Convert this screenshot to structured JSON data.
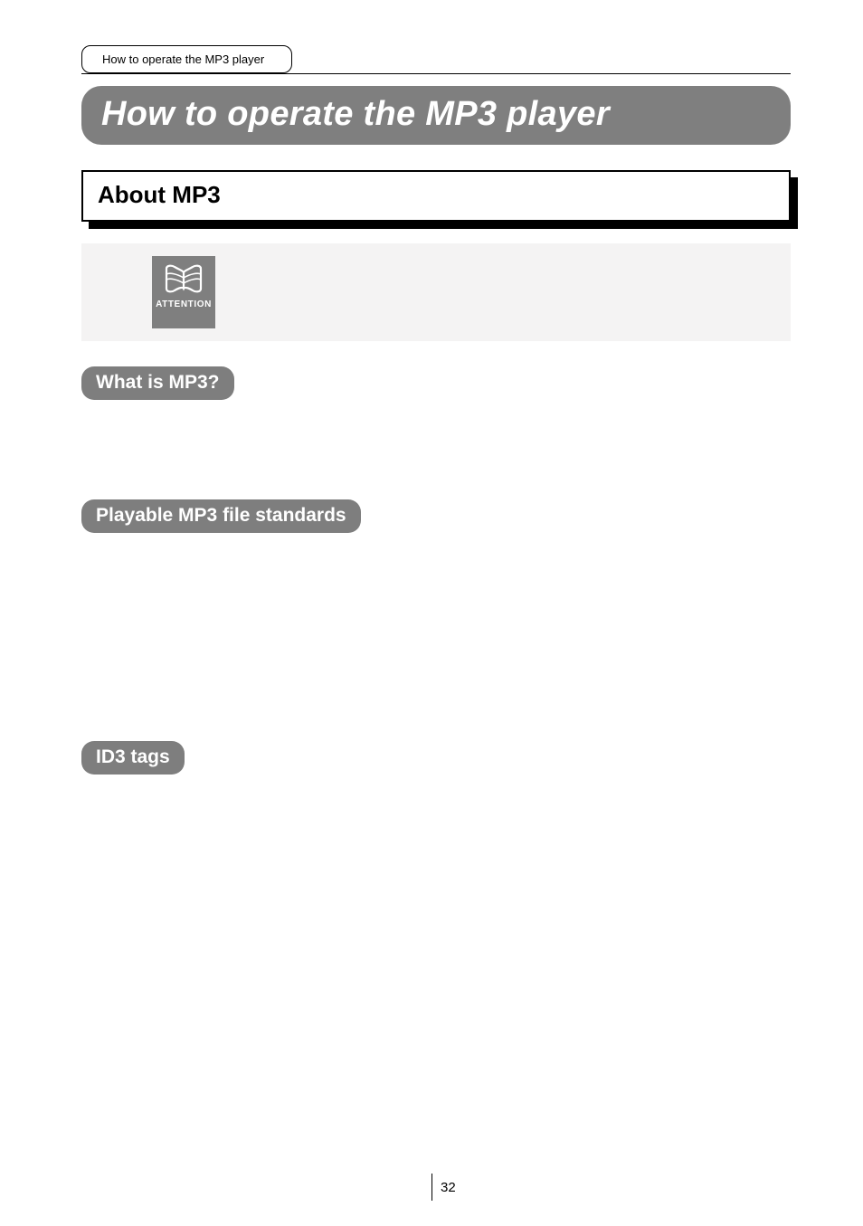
{
  "header": {
    "tab_label": "How to operate the MP3 player"
  },
  "title": "How to operate the MP3 player",
  "section": {
    "heading": "About MP3"
  },
  "attention": {
    "label": "ATTENTION"
  },
  "subsections": {
    "what_is_mp3": "What is MP3?",
    "playable_standards": "Playable MP3 file standards",
    "id3_tags": "ID3 tags"
  },
  "page_number": "32"
}
